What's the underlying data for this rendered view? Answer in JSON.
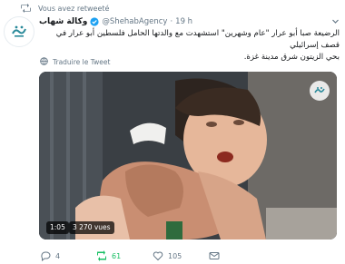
{
  "retweet_banner": {
    "text": "Vous avez retweeté"
  },
  "tweet": {
    "display_name": "وكالة شهاب",
    "handle": "@ShehabAgency",
    "separator": "·",
    "time": "19 h",
    "text_line1": "الرضيعة صبا أبو عرار \"عام وشهرين\" استشهدت مع والدتها الحامل فلسطين أبو عرار في قصف إسرائيلي",
    "text_line2": "بحي الزيتون شرق مدينة غزة.",
    "translate_label": "Traduire le Tweet"
  },
  "video": {
    "duration": "1:05",
    "views": "3 270 vues"
  },
  "actions": {
    "reply_count": "4",
    "retweet_count": "61",
    "like_count": "105"
  },
  "colors": {
    "retweet_active": "#17bf63",
    "verified": "#1da1f2",
    "muted": "#657786",
    "logo_teal": "#2a8a9a"
  },
  "icons": [
    "retweet-icon",
    "verified-badge-icon",
    "chevron-down-icon",
    "globe-icon",
    "reply-icon",
    "like-icon",
    "dm-icon",
    "logo-watermark"
  ]
}
